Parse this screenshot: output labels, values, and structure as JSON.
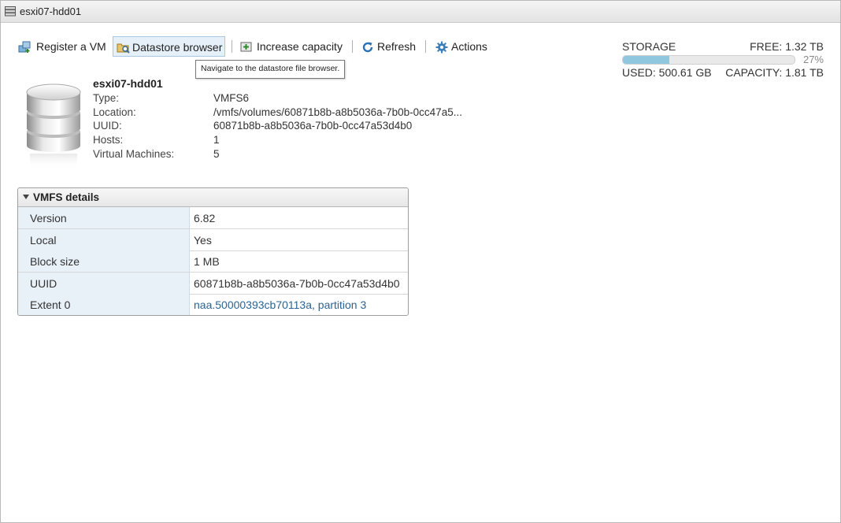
{
  "window": {
    "title": "esxi07-hdd01"
  },
  "toolbar": {
    "register_vm": "Register a VM",
    "datastore_browser": "Datastore browser",
    "increase_capacity": "Increase capacity",
    "refresh": "Refresh",
    "actions": "Actions"
  },
  "tooltip": "Navigate to the datastore file browser.",
  "storage": {
    "title": "STORAGE",
    "free": "FREE: 1.32 TB",
    "percent_label": "27%",
    "percent_used": 0.27,
    "used": "USED: 500.61 GB",
    "capacity": "CAPACITY: 1.81 TB",
    "bar_color": "#8fc8de"
  },
  "summary": {
    "name": "esxi07-hdd01",
    "rows": [
      {
        "key": "Type:",
        "value": "VMFS6"
      },
      {
        "key": "Location:",
        "value": "/vmfs/volumes/60871b8b-a8b5036a-7b0b-0cc47a5..."
      },
      {
        "key": "UUID:",
        "value": "60871b8b-a8b5036a-7b0b-0cc47a53d4b0"
      },
      {
        "key": "Hosts:",
        "value": "1"
      },
      {
        "key": "Virtual Machines:",
        "value": "5"
      }
    ]
  },
  "vmfs_details": {
    "title": "VMFS details",
    "rows": [
      {
        "key": "Version",
        "value": "6.82"
      },
      {
        "key": "Local",
        "value": "Yes"
      },
      {
        "key": "Block size",
        "value": "1 MB"
      },
      {
        "key": "UUID",
        "value": "60871b8b-a8b5036a-7b0b-0cc47a53d4b0"
      },
      {
        "key": "Extent 0",
        "value": "naa.50000393cb70113a, partition 3"
      }
    ]
  },
  "icons": {
    "title": "datastore-icon",
    "register_vm": "register-vm-icon",
    "datastore_browser": "datastore-browser-icon",
    "increase_capacity": "increase-capacity-icon",
    "refresh": "refresh-icon",
    "actions": "gear-icon",
    "large": "datastore-large-icon"
  }
}
